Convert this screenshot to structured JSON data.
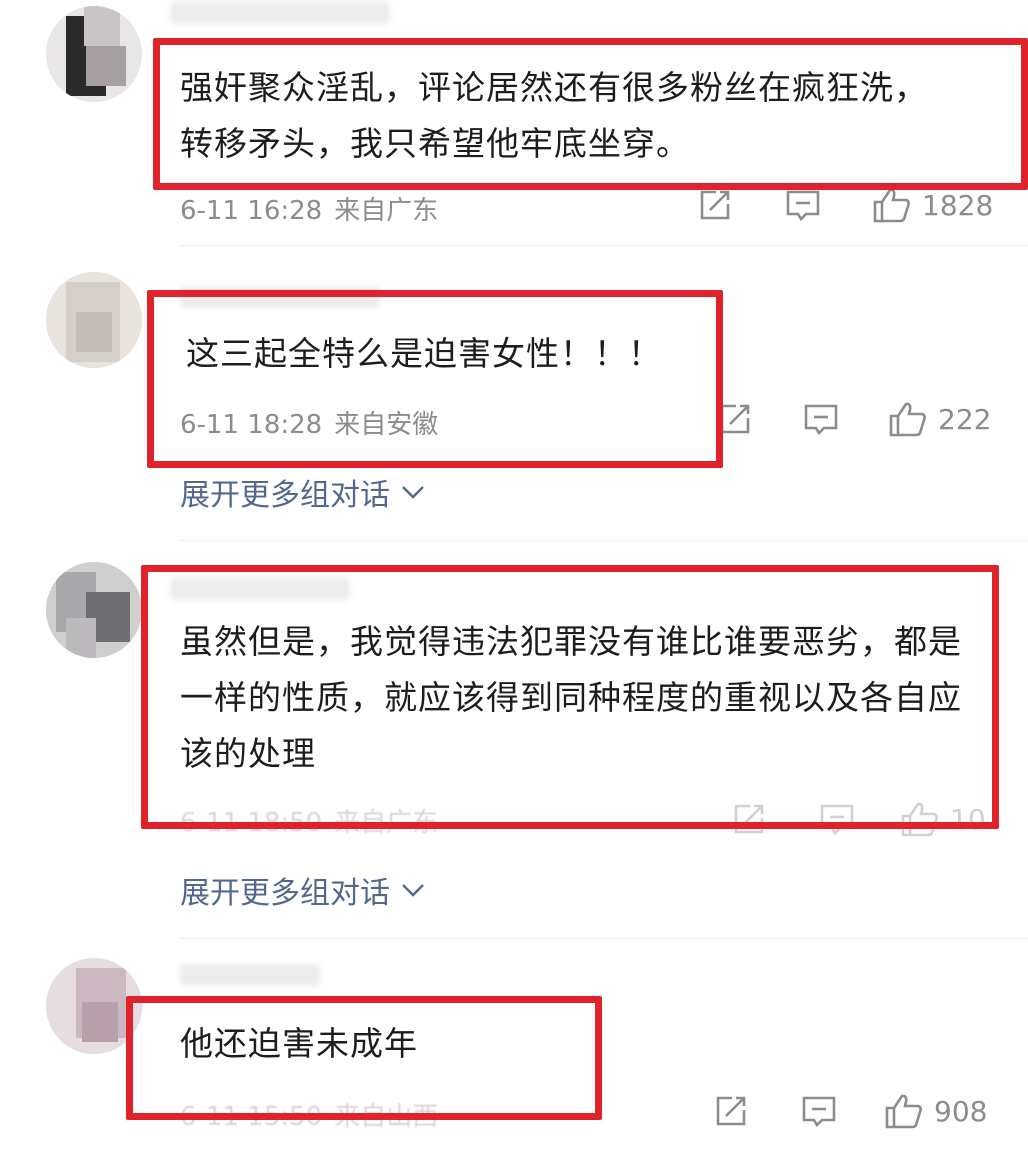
{
  "comments": [
    {
      "text": "强奸聚众淫乱，评论居然还有很多粉丝在疯狂洗，转移矛头，我只希望他牢底坐穿。",
      "time": "6-11 16:28",
      "location": "来自广东",
      "likes": "1828"
    },
    {
      "text": "这三起全特么是迫害女性！！！",
      "time": "6-11 18:28",
      "location": "来自安徽",
      "likes": "222",
      "expand_label": "展开更多组对话"
    },
    {
      "text": "虽然但是，我觉得违法犯罪没有谁比谁要恶劣，都是一样的性质，就应该得到同种程度的重视以及各自应该的处理",
      "time": "6-11 18:50",
      "location": "来自广东",
      "likes": "10",
      "expand_label": "展开更多组对话"
    },
    {
      "text": "他还迫害未成年",
      "time": "6-11 15:50",
      "location": "来自山西",
      "likes": "908"
    }
  ],
  "icons": {
    "repost": "share-edit-icon",
    "comment": "comment-bubble-icon",
    "like": "thumbs-up-icon",
    "expand": "chevron-down-icon"
  },
  "colors": {
    "highlight_box": "#e0222a",
    "link": "#53688f",
    "meta": "#8c8c8c"
  }
}
